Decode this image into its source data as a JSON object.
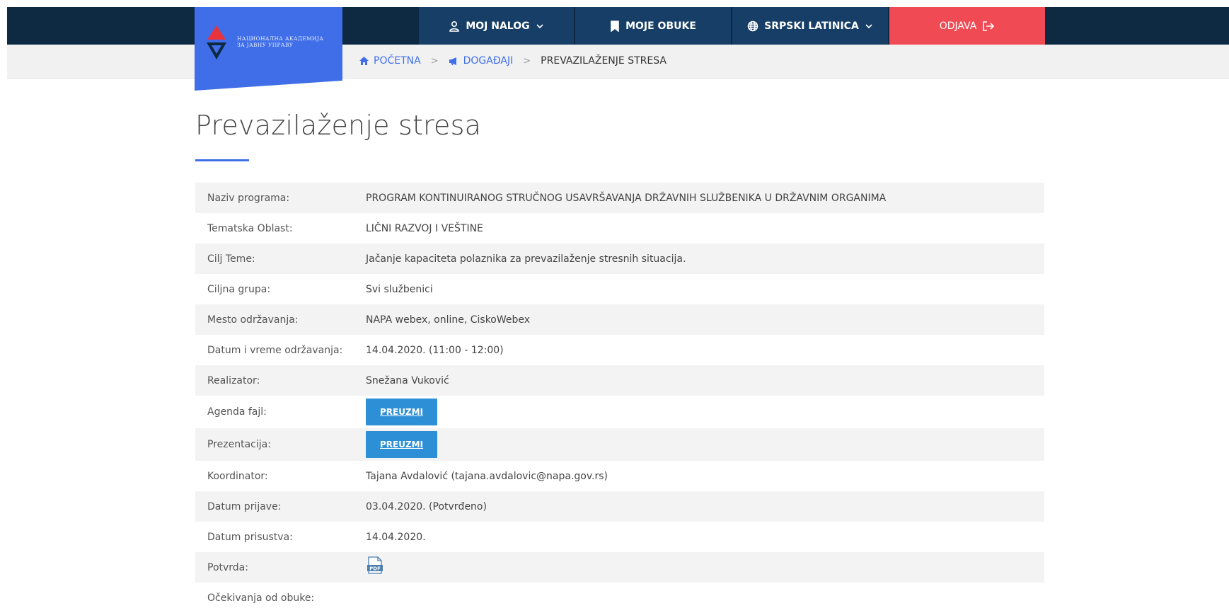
{
  "logo": {
    "line1": "НАЦИОНАЛНА АКАДЕМИЈА",
    "line2": "ЗА ЈАВНУ УПРАВУ",
    "brand_color": "#3f6ee8"
  },
  "nav": {
    "account": {
      "label": "MOJ NALOG",
      "icon": "user-icon"
    },
    "trainings": {
      "label": "MOJE OBUKE",
      "icon": "bookmark-icon"
    },
    "language": {
      "label": "SRPSKI LATINICA",
      "icon": "globe-icon"
    },
    "logout": {
      "label": "ODJAVA",
      "icon": "logout-icon",
      "color": "#f04b55"
    }
  },
  "breadcrumb": {
    "home": "POČETNA",
    "events": "DOGAĐAJI",
    "current": "PREVAZILAŽENJE STRESA"
  },
  "page": {
    "title": "Prevazilaženje stresa"
  },
  "details": {
    "program_label": "Naziv programa:",
    "program_value": "PROGRAM KONTINUIRANOG STRUČNOG USAVRŠAVANJA DRŽAVNIH SLUŽBENIKA U DRŽAVNIM ORGANIMA",
    "area_label": "Tematska Oblast:",
    "area_value": "LIČNI RAZVOJ I VEŠTINE",
    "goal_label": "Cilj Teme:",
    "goal_value": "Jačanje kapaciteta polaznika za prevazilaženje stresnih situacija.",
    "group_label": "Ciljna grupa:",
    "group_value": "Svi službenici",
    "place_label": "Mesto održavanja:",
    "place_value": "NAPA webex, online, CiskoWebex",
    "datetime_label": "Datum i vreme održavanja:",
    "datetime_value": "14.04.2020. (11:00 - 12:00)",
    "realizer_label": "Realizator:",
    "realizer_value": "Snežana Vuković",
    "agenda_label": "Agenda fajl:",
    "agenda_button": "PREUZMI",
    "presentation_label": "Prezentacija:",
    "presentation_button": "PREUZMI",
    "coordinator_label": "Koordinator:",
    "coordinator_value": "Tajana Avdalović (tajana.avdalovic@napa.gov.rs)",
    "applied_label": "Datum prijave:",
    "applied_value": "03.04.2020. (Potvrđeno)",
    "attended_label": "Datum prisustva:",
    "attended_value": "14.04.2020.",
    "certificate_label": "Potvrda:",
    "certificate_icon": "pdf-icon",
    "expectations_label": "Očekivanja od obuke:"
  }
}
